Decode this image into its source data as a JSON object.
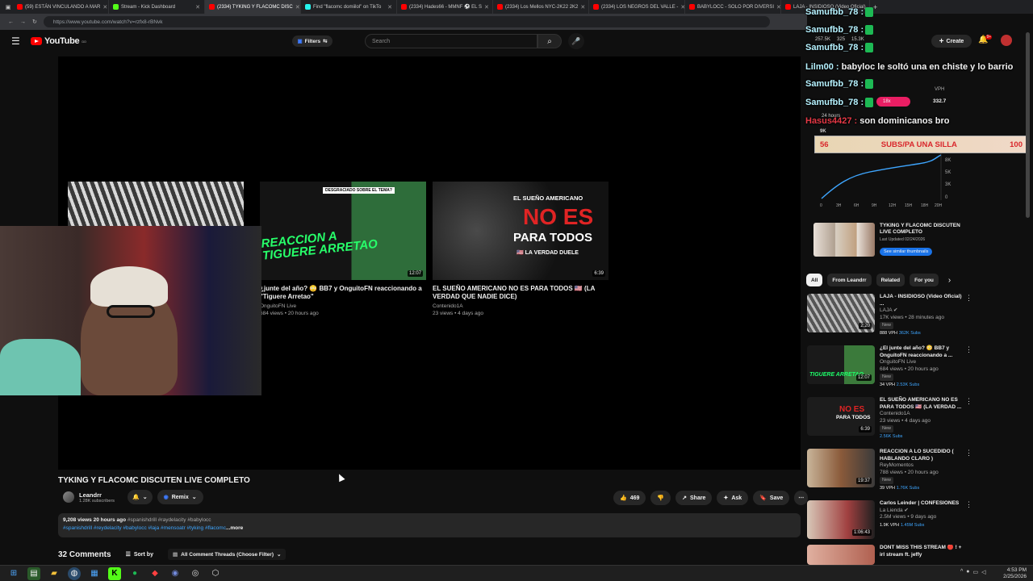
{
  "browser": {
    "tabs": [
      {
        "label": "(59) ESTÁN VINCULANDO A MAR",
        "color": "#ff0000"
      },
      {
        "label": "Stream - Kick Dashboard",
        "color": "#53fc18"
      },
      {
        "label": "(2334) TYKING Y FLACOMC DISC",
        "color": "#ff0000"
      },
      {
        "label": "Find \"flacomc domiilol\" on TikTo",
        "color": "#25f4ee"
      },
      {
        "label": "(2334) Hades66 - MMNF ⚽ EL S",
        "color": "#ff0000"
      },
      {
        "label": "(2334) Los Mellos NYC-2K22 2K2",
        "color": "#ff0000"
      },
      {
        "label": "(2334) LOS NEGROS DEL VALLE -",
        "color": "#ff0000"
      },
      {
        "label": "BABYLOCC - SOLO POR DIVERSI",
        "color": "#ff0000"
      },
      {
        "label": "LAJA - INSIDIOSO (Video Oficial)",
        "color": "#ff0000"
      }
    ],
    "url": "https://www.youtube.com/watch?v=rzfx8-rBNvk"
  },
  "header": {
    "logo_text": "YouTube",
    "country_code": "DO",
    "filters_label": "Filters",
    "search_placeholder": "Search",
    "create_label": "Create",
    "notif_badge": "9+"
  },
  "player": {
    "end_cards": [
      {
        "title": "",
        "meta": "",
        "duration": ""
      },
      {
        "title": "¿junte del año? 😳 BB7 y OnguitoFN reaccionando a \"Tiguere Arretao\"",
        "meta": "OnguitoFN Live\n684 views • 20 hours ago",
        "duration": "12:07",
        "overlay_top": "DESGRACIADO SOBRE EL TEMA?",
        "overlay_big": "REACCION A TIGUERE ARRETAO"
      },
      {
        "title": "EL SUEÑO AMERICANO NO ES PARA TODOS 🇺🇸 (LA VERDAD QUE NADIE DICE)",
        "meta": "Contenido1A\n23 views • 4 days ago",
        "duration": "6:39",
        "overlay_l1": "EL SUEÑO AMERICANO",
        "overlay_l2": "NO ES",
        "overlay_l3": "PARA TODOS",
        "overlay_l4": "🇺🇸 LA VERDAD DUELE"
      }
    ]
  },
  "video": {
    "title": "TYKING Y FLACOMC DISCUTEN LIVE COMPLETO",
    "channel": "Leandrr",
    "subscribers": "1.28K subscribers",
    "remix_label": "Remix",
    "likes": "469",
    "share_label": "Share",
    "ask_label": "Ask",
    "save_label": "Save",
    "desc_stats": "9,208 views  20 hours ago",
    "desc_tags_1": "#spanishdrill #raydelacity #babylocc",
    "desc_tags_2": "#spanishdrill #reydelacity #babylocc #laja #mensoatr #tyking #flacomc",
    "desc_more": "...more",
    "comments_count": "32 Comments",
    "sort_label": "Sort by",
    "filter_label": "All Comment Threads (Choose Filter)"
  },
  "chat_overlay": {
    "lines": [
      {
        "user": "Samufbb_78 :",
        "text": ""
      },
      {
        "user": "Samufbb_78 :",
        "text": ""
      },
      {
        "user": "Samufbb_78 :",
        "text": ""
      },
      {
        "user": "Lilm00 :",
        "text": " babyloc le soltó una en chiste y lo barrio"
      },
      {
        "user": "Samufbb_78 :",
        "text": ""
      },
      {
        "user": "Samufbb_78 :",
        "text": ""
      },
      {
        "user": "Hasus4427 :",
        "text": " son dominicanos bro"
      }
    ],
    "subs_left": "56",
    "subs_label": "SUBS/PA UNA SILLA",
    "subs_right": "100"
  },
  "analytics": {
    "stats": [
      "257.5K",
      "325",
      "15.3K"
    ],
    "vph_label": "VPH",
    "vph_value": "332.7",
    "multiplier": "18x",
    "hours_label": "24 hours",
    "views_label": "9K",
    "y_ticks": [
      "8K",
      "5K",
      "3K",
      "0"
    ],
    "x_ticks": [
      "0",
      "3H",
      "6H",
      "9H",
      "12H",
      "15H",
      "18H",
      "20H"
    ]
  },
  "similar": {
    "title": "TYKING Y FLACOMC DISCUTEN LIVE COMPLETO",
    "sub": "Last Updated 02/24/2026",
    "button": "See similar thumbnails"
  },
  "chips": [
    "All",
    "From Leandrr",
    "Related",
    "For you"
  ],
  "recommendations": [
    {
      "title": "LAJA - INSIDIOSO (Video Oficial) ...",
      "channel": "LAJA ✔",
      "meta": "17K views • 28 minutes ago",
      "badge": "New",
      "vph": "888 VPH",
      "subs": "362K Subs",
      "duration": "2:20",
      "color": "#6a6a6a"
    },
    {
      "title": "¿El junte del año? 😳 BB7 y OnguitoFN reaccionando a ...",
      "channel": "OnguitoFN Live",
      "meta": "684 views • 20 hours ago",
      "badge": "New",
      "vph": "34 VPH",
      "subs": "2.53K Subs",
      "duration": "12:07",
      "color": "#2a6a3a"
    },
    {
      "title": "EL SUEÑO AMERICANO NO ES PARA TODOS 🇺🇸 (LA VERDAD ...",
      "channel": "Contenido1A",
      "meta": "23 views • 4 days ago",
      "badge": "New",
      "vph": "",
      "subs": "2.56K Subs",
      "duration": "6:39",
      "color": "#3a3a3a"
    },
    {
      "title": "REACCION A LO SUCEDIDO ( HABLANDO CLARO )",
      "channel": "ReyMomentos",
      "meta": "788 views • 20 hours ago",
      "badge": "New",
      "vph": "39 VPH",
      "subs": "1.76K Subs",
      "duration": "19:37",
      "color": "#7a5a4a"
    },
    {
      "title": "Carlos Leinder | CONFESIONES",
      "channel": "La Lienda ✔",
      "meta": "2.5M views • 9 days ago",
      "badge": "",
      "vph": "1.9K VPH",
      "subs": "1.45M Subs",
      "duration": "1:06:43",
      "color": "#8a4040"
    },
    {
      "title": "DONT MISS THIS STREAM 🔴 ! + irl stream ft. jeffy",
      "channel": "",
      "meta": "",
      "badge": "",
      "vph": "",
      "subs": "",
      "duration": "",
      "color": "#b07060"
    }
  ],
  "taskbar": {
    "time": "4:53 PM",
    "date": "2/25/2026"
  },
  "colors": {
    "accent_red": "#ff0000",
    "link_blue": "#3ea6ff",
    "vph_red": "#e91e63"
  }
}
